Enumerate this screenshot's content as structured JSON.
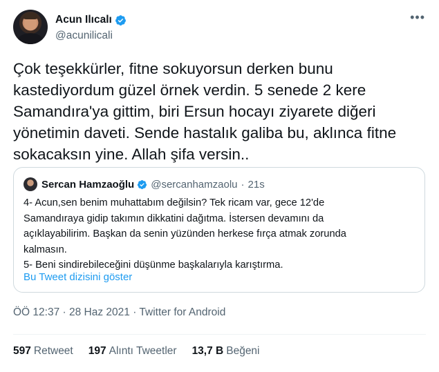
{
  "author": {
    "display_name": "Acun Ilıcalı",
    "handle": "@acunilicali"
  },
  "tweet": {
    "text": "Çok teşekkürler, fitne sokuyorsun derken bunu\nkastediyordum güzel örnek verdin. 5 senede 2 kere\nSamandıra'ya gittim, biri Ersun hocayı ziyarete diğeri\nyönetimin daveti. Sende hastalık galiba bu, aklınca fitne\nsokacaksın yine. Allah şifa versin.."
  },
  "quote": {
    "display_name": "Sercan Hamzaoğlu",
    "handle": "@sercanhamzaolu",
    "separator": "·",
    "time": "21s",
    "lines": [
      "4- Acun,sen benim muhattabım değilsin? Tek ricam var, gece 12'de",
      "Samandıraya gidip takımın dikkatini dağıtma. İstersen devamını da",
      "açıklayabilirim. Başkan da senin yüzünden herkese fırça atmak zorunda",
      "kalmasın.",
      "5- Beni sindirebileceğini düşünme başkalarıyla karıştırma."
    ],
    "show_thread": "Bu Tweet dizisini göster"
  },
  "meta": {
    "time": "ÖÖ 12:37",
    "sep1": " · ",
    "date": "28 Haz 2021",
    "sep2": " · ",
    "source": "Twitter for Android"
  },
  "stats": {
    "retweets": {
      "num": "597",
      "label": "Retweet"
    },
    "quotes": {
      "num": "197",
      "label": "Alıntı Tweetler"
    },
    "likes": {
      "num": "13,7 B",
      "label": "Beğeni"
    }
  },
  "icons": {
    "verified": "verified-badge-icon",
    "more": "more-options-icon"
  },
  "colors": {
    "accent": "#1d9bf0",
    "text": "#0f1419",
    "secondary": "#536471",
    "border": "#cfd9de"
  }
}
